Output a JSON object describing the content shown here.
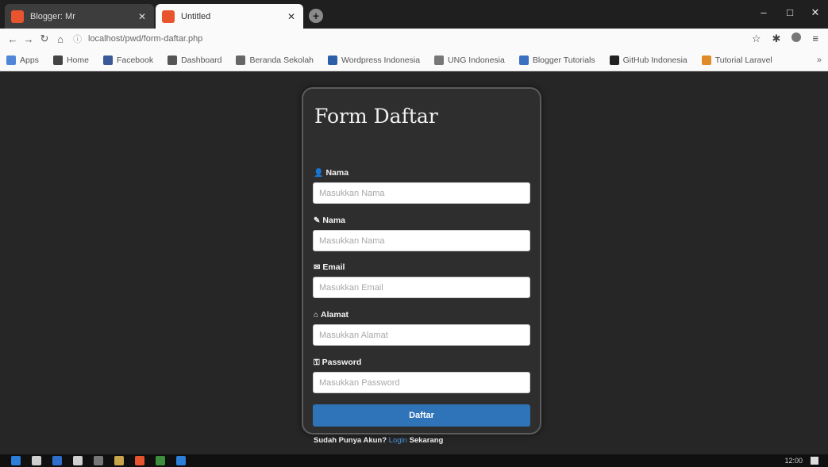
{
  "browser": {
    "tabs": [
      {
        "title": "Blogger: Mr",
        "active": false
      },
      {
        "title": "Untitled",
        "active": true
      }
    ],
    "new_tab_icon": "plus-icon",
    "window_controls": {
      "minimize": "–",
      "maximize": "□",
      "close": "✕"
    },
    "toolbar": {
      "back": "←",
      "forward": "→",
      "reload": "↻",
      "home": "⌂",
      "url": "localhost/pwd/form-daftar.php",
      "right_icons": [
        "☆",
        "✱",
        "≡"
      ]
    },
    "bookmarks": [
      {
        "label": "Apps",
        "color": "#4f86d6"
      },
      {
        "label": "Home",
        "color": "#444444"
      },
      {
        "label": "Facebook",
        "color": "#3b5998"
      },
      {
        "label": "Dashboard",
        "color": "#555555"
      },
      {
        "label": "Beranda Sekolah",
        "color": "#666666"
      },
      {
        "label": "Wordpress Indonesia",
        "color": "#2d5fa8"
      },
      {
        "label": "UNG Indonesia",
        "color": "#777777"
      },
      {
        "label": "Blogger Tutorials",
        "color": "#3a6fc1"
      },
      {
        "label": "GitHub Indonesia",
        "color": "#222222"
      },
      {
        "label": "Tutorial Laravel",
        "color": "#e08a2a"
      }
    ],
    "bookmarks_more": "»"
  },
  "form": {
    "title": "Form Daftar",
    "fields": [
      {
        "icon": "👤",
        "label": "Nama",
        "placeholder": "Masukkan Nama"
      },
      {
        "icon": "✎",
        "label": "Nama",
        "placeholder": "Masukkan Nama"
      },
      {
        "icon": "✉",
        "label": "Email",
        "placeholder": "Masukkan Email"
      },
      {
        "icon": "⌂",
        "label": "Alamat",
        "placeholder": "Masukkan Alamat"
      },
      {
        "icon": "⚿",
        "label": "Password",
        "placeholder": "Masukkan Password"
      }
    ],
    "submit_label": "Daftar",
    "footer_text": "Sudah Punya Akun?",
    "footer_link": "Login",
    "footer_suffix": "Sekarang"
  },
  "taskbar": {
    "apps": [
      "#2b7fd8",
      "#cfcfcf",
      "#2f6fcb",
      "#d0d0d0",
      "#777777",
      "#c8a44a",
      "#e8542e",
      "#3d8f3d",
      "#2b7fd8"
    ],
    "tray_time": "12:00"
  }
}
